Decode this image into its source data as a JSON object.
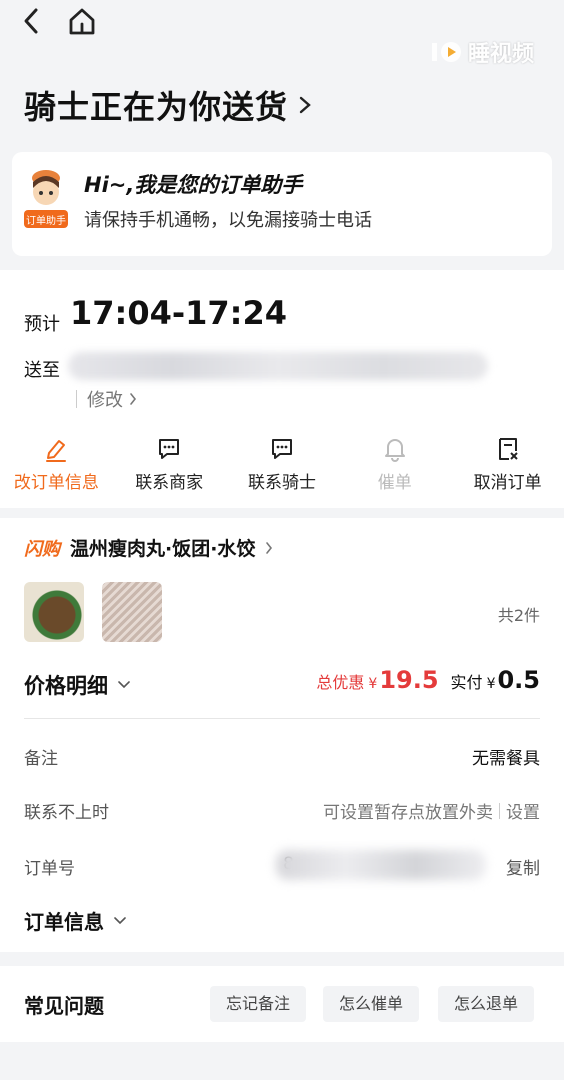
{
  "watermark": {
    "text": "睡视频"
  },
  "status": {
    "title": "骑士正在为你送货"
  },
  "assistant": {
    "badge": "订单助手",
    "title": "Hi~,我是您的订单助手",
    "subtitle": "请保持手机通畅，以免漏接骑士电话"
  },
  "delivery": {
    "eta_label": "预计",
    "eta_time": "17:04-17:24",
    "address_label": "送至",
    "edit_label": "修改"
  },
  "actions": [
    {
      "label": "改订单信息",
      "icon": "edit-icon",
      "state": "active"
    },
    {
      "label": "联系商家",
      "icon": "chat-icon",
      "state": "normal"
    },
    {
      "label": "联系骑士",
      "icon": "chat-icon",
      "state": "normal"
    },
    {
      "label": "催单",
      "icon": "bell-icon",
      "state": "disabled"
    },
    {
      "label": "取消订单",
      "icon": "cancel-doc-icon",
      "state": "normal"
    }
  ],
  "shop": {
    "tag": "闪购",
    "name": "温州瘦肉丸·饭团·水饺"
  },
  "items": {
    "count_label": "共2件"
  },
  "price": {
    "title": "价格明细",
    "discount_label": "总优惠",
    "currency": "¥",
    "discount_value": "19.5",
    "paid_label": "实付",
    "paid_value": "0.5"
  },
  "info": {
    "remark_label": "备注",
    "remark_value": "无需餐具",
    "unreachable_label": "联系不上时",
    "unreachable_value": "可设置暂存点放置外卖",
    "unreachable_action": "设置",
    "order_no_label": "订单号",
    "order_no_prefix": "8",
    "copy_label": "复制",
    "order_info_label": "订单信息"
  },
  "faq": {
    "title": "常见问题",
    "chips": [
      "忘记备注",
      "怎么催单",
      "怎么退单"
    ]
  },
  "colors": {
    "accent": "#f06a1c",
    "discount": "#e43b3b",
    "background": "#f3f4f6"
  }
}
